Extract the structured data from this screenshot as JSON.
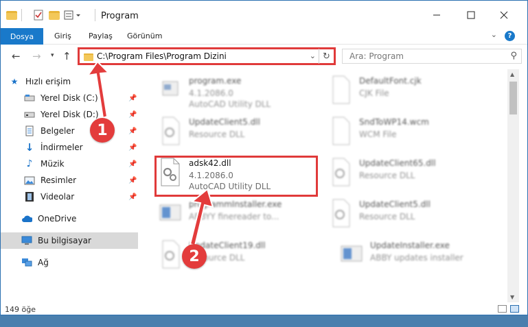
{
  "window": {
    "title": "Program"
  },
  "ribbon": {
    "tabs": [
      "Dosya",
      "Giriş",
      "Paylaş",
      "Görünüm"
    ],
    "help_label": "?"
  },
  "address_bar": {
    "path": "C:\\Program Files\\Program Dizini"
  },
  "search": {
    "placeholder": "Ara: Program"
  },
  "sidebar": {
    "quick_access": "Hızlı erişim",
    "items": [
      {
        "label": "Yerel Disk (C:)",
        "icon": "drive-icon",
        "pinned": true
      },
      {
        "label": "Yerel Disk (D:)",
        "icon": "drive-icon",
        "pinned": true
      },
      {
        "label": "Belgeler",
        "icon": "documents-icon",
        "pinned": true
      },
      {
        "label": "İndirmeler",
        "icon": "download-icon",
        "pinned": true
      },
      {
        "label": "Müzik",
        "icon": "music-icon",
        "pinned": true
      },
      {
        "label": "Resimler",
        "icon": "pictures-icon",
        "pinned": true
      },
      {
        "label": "Videolar",
        "icon": "videos-icon",
        "pinned": true
      }
    ],
    "onedrive": "OneDrive",
    "this_pc": "Bu bilgisayar",
    "network": "Ağ"
  },
  "files": [
    {
      "name": "program.exe",
      "line1": "4.1.2086.0",
      "line2": "AutoCAD Utility DLL",
      "blurred": true
    },
    {
      "name": "DefaultFont.cjk",
      "line1": "CJK File",
      "line2": "",
      "blurred": true
    },
    {
      "name": "UpdateClient5.dll",
      "line1": "Resource DLL",
      "line2": "",
      "blurred": true
    },
    {
      "name": "SndToWP14.wcm",
      "line1": "WCM File",
      "line2": "",
      "blurred": true
    },
    {
      "name": "adsk42.dll",
      "line1": "4.1.2086.0",
      "line2": "AutoCAD Utility DLL",
      "blurred": false
    },
    {
      "name": "UpdateClient65.dll",
      "line1": "Resource DLL",
      "line2": "",
      "blurred": true
    },
    {
      "name": "programmInstaller.exe",
      "line1": "ABBYY finereader to...",
      "line2": "",
      "blurred": true
    },
    {
      "name": "UpdateClient5.dll",
      "line1": "Resource DLL",
      "line2": "",
      "blurred": true
    },
    {
      "name": "UpdateClient19.dll",
      "line1": "Resource DLL",
      "line2": "",
      "blurred": true
    },
    {
      "name": "UpdateInstaller.exe",
      "line1": "ABBY updates installer",
      "line2": "",
      "blurred": true
    }
  ],
  "status": {
    "count": "149 öğe"
  },
  "annotations": {
    "step1": "1",
    "step2": "2",
    "color": "#e33c3c"
  }
}
